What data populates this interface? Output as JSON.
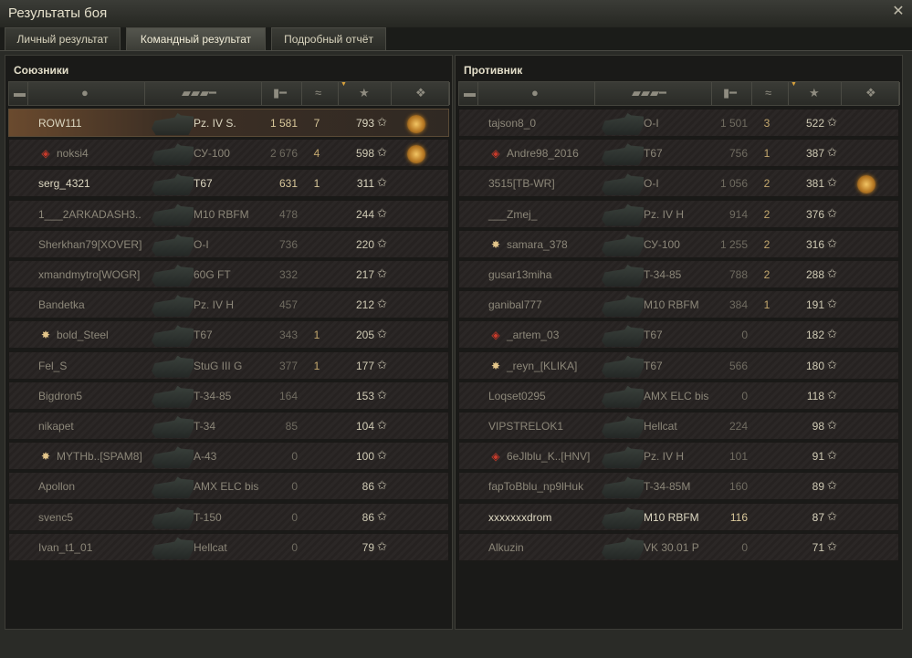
{
  "window": {
    "title": "Результаты боя",
    "close_icon": "close-icon"
  },
  "tabs": [
    {
      "label": "Личный результат",
      "active": false
    },
    {
      "label": "Командный результат",
      "active": true
    },
    {
      "label": "Подробный отчёт",
      "active": false
    }
  ],
  "columns": {
    "icons": [
      "squad-icon",
      "player-icon",
      "tank-icon",
      "damage-icon",
      "kills-icon",
      "experience-icon",
      "medal-icon"
    ],
    "sorted_by": "experience"
  },
  "allies": {
    "title": "Союзники",
    "rows": [
      {
        "name": "ROW111",
        "vehicle": "Pz. IV S.",
        "damage": "1 581",
        "kills": "7",
        "xp": "793",
        "alive": true,
        "player": true,
        "badge": "",
        "medal": true
      },
      {
        "name": "noksi4",
        "vehicle": "СУ-100",
        "damage": "2 676",
        "kills": "4",
        "xp": "598",
        "alive": false,
        "player": false,
        "badge": "diamond",
        "medal": true
      },
      {
        "name": "serg_4321",
        "vehicle": "T67",
        "damage": "631",
        "kills": "1",
        "xp": "311",
        "alive": true,
        "player": false,
        "badge": "",
        "medal": false
      },
      {
        "name": "1___2ARKADASH3..",
        "vehicle": "M10 RBFM",
        "damage": "478",
        "kills": "",
        "xp": "244",
        "alive": false,
        "player": false,
        "badge": "",
        "medal": false
      },
      {
        "name": "Sherkhan79[XOVER]",
        "vehicle": "O-I",
        "damage": "736",
        "kills": "",
        "xp": "220",
        "alive": false,
        "player": false,
        "badge": "",
        "medal": false
      },
      {
        "name": "xmandmytro[WOGR]",
        "vehicle": "60G FT",
        "damage": "332",
        "kills": "",
        "xp": "217",
        "alive": false,
        "player": false,
        "badge": "",
        "medal": false
      },
      {
        "name": "Bandetka",
        "vehicle": "Pz. IV H",
        "damage": "457",
        "kills": "",
        "xp": "212",
        "alive": false,
        "player": false,
        "badge": "",
        "medal": false
      },
      {
        "name": "bold_Steel",
        "vehicle": "T67",
        "damage": "343",
        "kills": "1",
        "xp": "205",
        "alive": false,
        "player": false,
        "badge": "star",
        "medal": false
      },
      {
        "name": "Fel_S",
        "vehicle": "StuG III G",
        "damage": "377",
        "kills": "1",
        "xp": "177",
        "alive": false,
        "player": false,
        "badge": "",
        "medal": false
      },
      {
        "name": "Bigdron5",
        "vehicle": "T-34-85",
        "damage": "164",
        "kills": "",
        "xp": "153",
        "alive": false,
        "player": false,
        "badge": "",
        "medal": false
      },
      {
        "name": "nikapet",
        "vehicle": "T-34",
        "damage": "85",
        "kills": "",
        "xp": "104",
        "alive": false,
        "player": false,
        "badge": "",
        "medal": false
      },
      {
        "name": "MYTHb..[SPAM8]",
        "vehicle": "A-43",
        "damage": "0",
        "kills": "",
        "xp": "100",
        "alive": false,
        "player": false,
        "badge": "star",
        "medal": false
      },
      {
        "name": "Apollon",
        "vehicle": "AMX ELC bis",
        "damage": "0",
        "kills": "",
        "xp": "86",
        "alive": false,
        "player": false,
        "badge": "",
        "medal": false
      },
      {
        "name": "svenc5",
        "vehicle": "T-150",
        "damage": "0",
        "kills": "",
        "xp": "86",
        "alive": false,
        "player": false,
        "badge": "",
        "medal": false
      },
      {
        "name": "Ivan_t1_01",
        "vehicle": "Hellcat",
        "damage": "0",
        "kills": "",
        "xp": "79",
        "alive": false,
        "player": false,
        "badge": "",
        "medal": false
      }
    ]
  },
  "enemies": {
    "title": "Противник",
    "rows": [
      {
        "name": "tajson8_0",
        "vehicle": "O-I",
        "damage": "1 501",
        "kills": "3",
        "xp": "522",
        "alive": false,
        "player": false,
        "badge": "",
        "medal": false
      },
      {
        "name": "Andre98_2016",
        "vehicle": "T67",
        "damage": "756",
        "kills": "1",
        "xp": "387",
        "alive": false,
        "player": false,
        "badge": "diamond",
        "medal": false
      },
      {
        "name": "3515[TB-WR]",
        "vehicle": "O-I",
        "damage": "1 056",
        "kills": "2",
        "xp": "381",
        "alive": false,
        "player": false,
        "badge": "",
        "medal": true
      },
      {
        "name": "___Zmej_",
        "vehicle": "Pz. IV H",
        "damage": "914",
        "kills": "2",
        "xp": "376",
        "alive": false,
        "player": false,
        "badge": "",
        "medal": false
      },
      {
        "name": "samara_378",
        "vehicle": "СУ-100",
        "damage": "1 255",
        "kills": "2",
        "xp": "316",
        "alive": false,
        "player": false,
        "badge": "star",
        "medal": false
      },
      {
        "name": "gusar13miha",
        "vehicle": "T-34-85",
        "damage": "788",
        "kills": "2",
        "xp": "288",
        "alive": false,
        "player": false,
        "badge": "",
        "medal": false
      },
      {
        "name": "ganibal777",
        "vehicle": "M10 RBFM",
        "damage": "384",
        "kills": "1",
        "xp": "191",
        "alive": false,
        "player": false,
        "badge": "",
        "medal": false
      },
      {
        "name": "_artem_03",
        "vehicle": "T67",
        "damage": "0",
        "kills": "",
        "xp": "182",
        "alive": false,
        "player": false,
        "badge": "diamond",
        "medal": false
      },
      {
        "name": "_reyn_[KLIKA]",
        "vehicle": "T67",
        "damage": "566",
        "kills": "",
        "xp": "180",
        "alive": false,
        "player": false,
        "badge": "star",
        "medal": false
      },
      {
        "name": "Loqset0295",
        "vehicle": "AMX ELC bis",
        "damage": "0",
        "kills": "",
        "xp": "118",
        "alive": false,
        "player": false,
        "badge": "",
        "medal": false
      },
      {
        "name": "VIPSTRELOK1",
        "vehicle": "Hellcat",
        "damage": "224",
        "kills": "",
        "xp": "98",
        "alive": false,
        "player": false,
        "badge": "",
        "medal": false
      },
      {
        "name": "6eJlblu_K..[HNV]",
        "vehicle": "Pz. IV H",
        "damage": "101",
        "kills": "",
        "xp": "91",
        "alive": false,
        "player": false,
        "badge": "diamond",
        "medal": false
      },
      {
        "name": "fapToBblu_np9lHuk",
        "vehicle": "T-34-85M",
        "damage": "160",
        "kills": "",
        "xp": "89",
        "alive": false,
        "player": false,
        "badge": "",
        "medal": false
      },
      {
        "name": "xxxxxxxdrom",
        "vehicle": "M10 RBFM",
        "damage": "116",
        "kills": "",
        "xp": "87",
        "alive": true,
        "player": false,
        "badge": "",
        "medal": false
      },
      {
        "name": "Alkuzin",
        "vehicle": "VK 30.01 P",
        "damage": "0",
        "kills": "",
        "xp": "71",
        "alive": false,
        "player": false,
        "badge": "",
        "medal": false
      }
    ]
  }
}
